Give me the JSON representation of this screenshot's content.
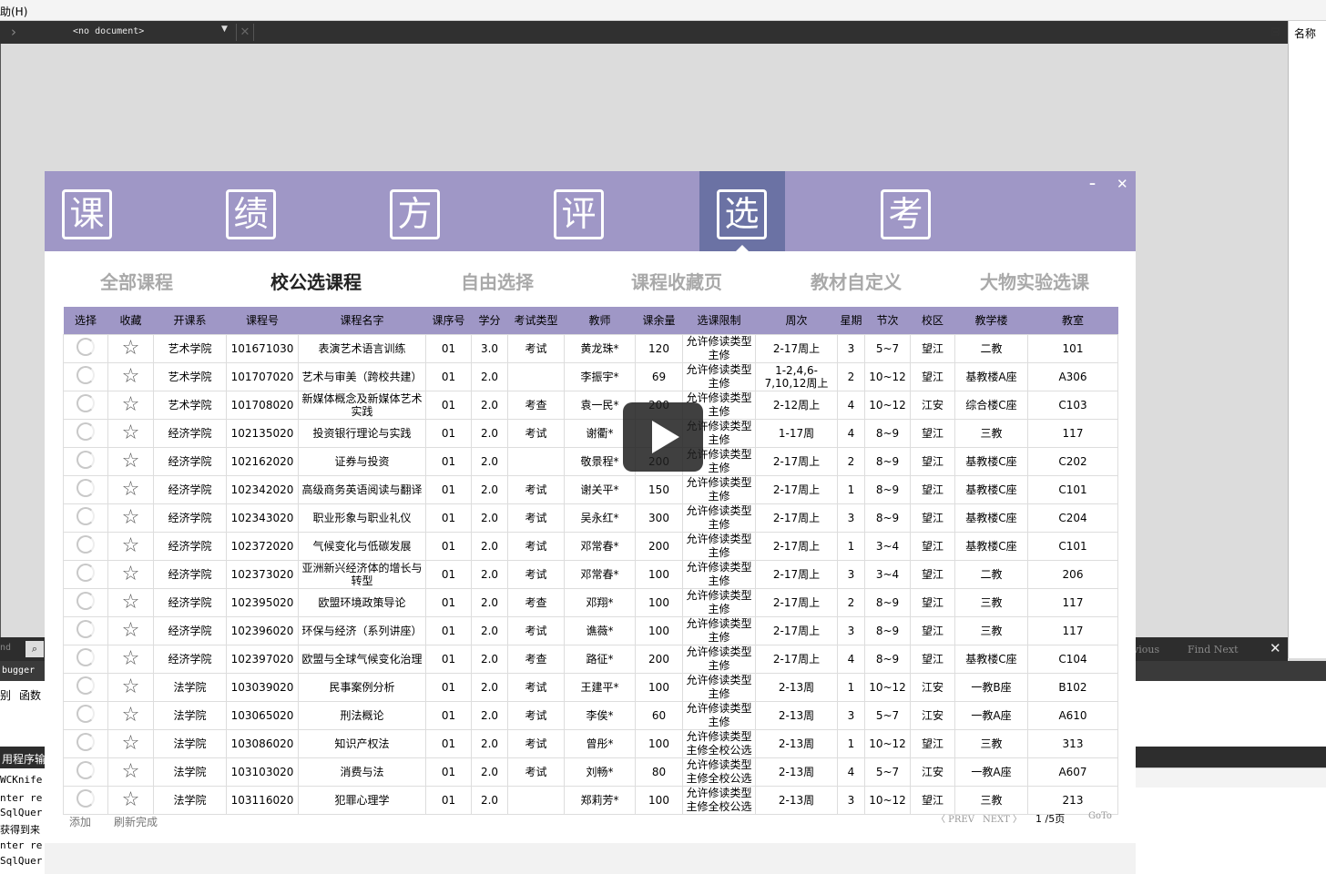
{
  "ide": {
    "menu_help": "助(H)",
    "doc_name": "<no document>",
    "right_panel_label": "名称",
    "find_left": "nd",
    "find_prev": "vious",
    "find_next": "Find Next",
    "debugger_label": "bugger",
    "tab_a": "别",
    "tab_b": "函数",
    "output_label": "用程序输",
    "console_lines": [
      "WCKnife",
      "nter re",
      "SqlQuer",
      "获得到来",
      "nter re",
      "SqlQuer"
    ]
  },
  "app": {
    "nav": [
      {
        "label": "课",
        "active": false
      },
      {
        "label": "绩",
        "active": false
      },
      {
        "label": "方",
        "active": false
      },
      {
        "label": "评",
        "active": false
      },
      {
        "label": "选",
        "active": true
      },
      {
        "label": "考",
        "active": false
      }
    ],
    "window_min": "–",
    "window_close": "✕",
    "tabs": [
      {
        "label": "全部课程",
        "active": false
      },
      {
        "label": "校公选课程",
        "active": true
      },
      {
        "label": "自由选择",
        "active": false
      },
      {
        "label": "课程收藏页",
        "active": false
      },
      {
        "label": "教材自定义",
        "active": false
      },
      {
        "label": "大物实验选课",
        "active": false
      }
    ],
    "columns": [
      "选择",
      "收藏",
      "开课系",
      "课程号",
      "课程名字",
      "课序号",
      "学分",
      "考试类型",
      "教师",
      "课余量",
      "选课限制",
      "周次",
      "星期",
      "节次",
      "校区",
      "教学楼",
      "教室"
    ],
    "rows": [
      [
        "艺术学院",
        "101671030",
        "表演艺术语言训练",
        "01",
        "3.0",
        "考试",
        "黄龙珠*",
        "120",
        "允许修读类型\n主修",
        "2-17周上",
        "3",
        "5~7",
        "望江",
        "二教",
        "101"
      ],
      [
        "艺术学院",
        "101707020",
        "艺术与审美（跨校共建）",
        "01",
        "2.0",
        "",
        "李振宇*",
        "69",
        "允许修读类型\n主修",
        "1-2,4,6-7,10,12周上",
        "2",
        "10~12",
        "望江",
        "基教楼A座",
        "A306"
      ],
      [
        "艺术学院",
        "101708020",
        "新媒体概念及新媒体艺术实践",
        "01",
        "2.0",
        "考查",
        "袁一民*",
        "200",
        "允许修读类型\n主修",
        "2-12周上",
        "4",
        "10~12",
        "江安",
        "综合楼C座",
        "C103"
      ],
      [
        "经济学院",
        "102135020",
        "投资银行理论与实践",
        "01",
        "2.0",
        "考试",
        "谢衢*",
        "",
        "允许修读类型\n主修",
        "1-17周",
        "4",
        "8~9",
        "望江",
        "三教",
        "117"
      ],
      [
        "经济学院",
        "102162020",
        "证券与投资",
        "01",
        "2.0",
        "",
        "敬景程*",
        "200",
        "允许修读类型\n主修",
        "2-17周上",
        "2",
        "8~9",
        "望江",
        "基教楼C座",
        "C202"
      ],
      [
        "经济学院",
        "102342020",
        "高级商务英语阅读与翻译",
        "01",
        "2.0",
        "考试",
        "谢关平*",
        "150",
        "允许修读类型\n主修",
        "2-17周上",
        "1",
        "8~9",
        "望江",
        "基教楼C座",
        "C101"
      ],
      [
        "经济学院",
        "102343020",
        "职业形象与职业礼仪",
        "01",
        "2.0",
        "考试",
        "吴永红*",
        "300",
        "允许修读类型\n主修",
        "2-17周上",
        "3",
        "8~9",
        "望江",
        "基教楼C座",
        "C204"
      ],
      [
        "经济学院",
        "102372020",
        "气候变化与低碳发展",
        "01",
        "2.0",
        "考试",
        "邓常春*",
        "200",
        "允许修读类型\n主修",
        "2-17周上",
        "1",
        "3~4",
        "望江",
        "基教楼C座",
        "C101"
      ],
      [
        "经济学院",
        "102373020",
        "亚洲新兴经济体的增长与转型",
        "01",
        "2.0",
        "考试",
        "邓常春*",
        "100",
        "允许修读类型\n主修",
        "2-17周上",
        "3",
        "3~4",
        "望江",
        "二教",
        "206"
      ],
      [
        "经济学院",
        "102395020",
        "欧盟环境政策导论",
        "01",
        "2.0",
        "考查",
        "邓翔*",
        "100",
        "允许修读类型\n主修",
        "2-17周上",
        "2",
        "8~9",
        "望江",
        "三教",
        "117"
      ],
      [
        "经济学院",
        "102396020",
        "环保与经济（系列讲座）",
        "01",
        "2.0",
        "考试",
        "谯薇*",
        "100",
        "允许修读类型\n主修",
        "2-17周上",
        "3",
        "8~9",
        "望江",
        "三教",
        "117"
      ],
      [
        "经济学院",
        "102397020",
        "欧盟与全球气候变化治理",
        "01",
        "2.0",
        "考查",
        "路征*",
        "200",
        "允许修读类型\n主修",
        "2-17周上",
        "4",
        "8~9",
        "望江",
        "基教楼C座",
        "C104"
      ],
      [
        "法学院",
        "103039020",
        "民事案例分析",
        "01",
        "2.0",
        "考试",
        "王建平*",
        "100",
        "允许修读类型\n主修",
        "2-13周",
        "1",
        "10~12",
        "江安",
        "一教B座",
        "B102"
      ],
      [
        "法学院",
        "103065020",
        "刑法概论",
        "01",
        "2.0",
        "考试",
        "李俟*",
        "60",
        "允许修读类型\n主修",
        "2-13周",
        "3",
        "5~7",
        "江安",
        "一教A座",
        "A610"
      ],
      [
        "法学院",
        "103086020",
        "知识产权法",
        "01",
        "2.0",
        "考试",
        "曾彤*",
        "100",
        "允许修读类型\n主修全校公选",
        "2-13周",
        "1",
        "10~12",
        "望江",
        "三教",
        "313"
      ],
      [
        "法学院",
        "103103020",
        "消费与法",
        "01",
        "2.0",
        "考试",
        "刘畅*",
        "80",
        "允许修读类型\n主修全校公选",
        "2-13周",
        "4",
        "5~7",
        "江安",
        "一教A座",
        "A607"
      ],
      [
        "法学院",
        "103116020",
        "犯罪心理学",
        "01",
        "2.0",
        "",
        "郑莉芳*",
        "100",
        "允许修读类型\n主修全校公选",
        "2-13周",
        "3",
        "10~12",
        "望江",
        "三教",
        "213"
      ]
    ],
    "footer": {
      "add": "添加",
      "status": "刷新完成",
      "prev": "〈 PREV",
      "next": "NEXT 〉",
      "page_current": "1",
      "page_total": "/5页",
      "goto": "GoTo"
    }
  }
}
